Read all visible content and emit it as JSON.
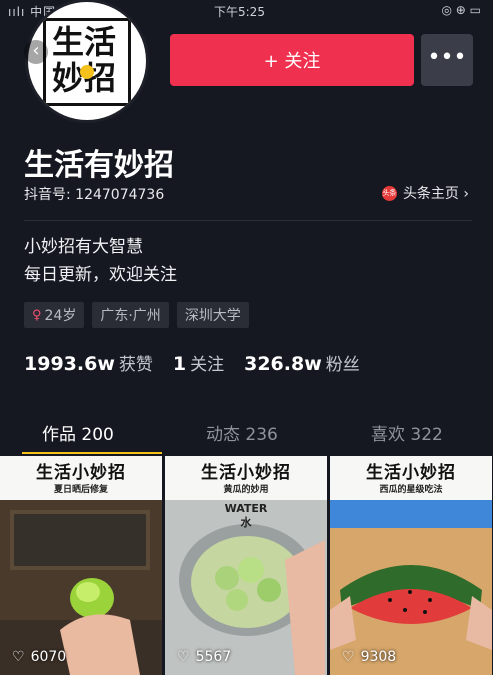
{
  "status_bar": {
    "left": "ıılı 中国移动",
    "time": "下午5:25",
    "right": "◎ ⊕ ▭"
  },
  "avatar": {
    "text_line1": "生活",
    "text_line2": "妙招"
  },
  "header": {
    "follow_label": "+ 关注",
    "more_label": "•••"
  },
  "profile": {
    "name": "生活有妙招",
    "douyin_id": "抖音号: 1247074736",
    "toutiao_label": "头条主页 ›",
    "bio_line1": "小妙招有大智慧",
    "bio_line2": "每日更新，欢迎关注"
  },
  "tags": [
    "24岁",
    "广东·广州",
    "深圳大学"
  ],
  "stats": {
    "likes_value": "1993.6w",
    "likes_label": "获赞",
    "following_value": "1",
    "following_label": "关注",
    "followers_value": "326.8w",
    "followers_label": "粉丝"
  },
  "tabs": [
    "作品 200",
    "动态 236",
    "喜欢 322"
  ],
  "videos": [
    {
      "title": "生活小妙招",
      "subtitle": "夏日晒后修复",
      "likes": "6070"
    },
    {
      "title": "生活小妙招",
      "subtitle": "黄瓜的妙用",
      "overlay": "WATER",
      "overlay2": "水",
      "likes": "5567"
    },
    {
      "title": "生活小妙招",
      "subtitle": "西瓜的星级吃法",
      "likes": "9308"
    }
  ],
  "colors": {
    "background": "#151821",
    "follow_button": "#f0304f",
    "accent": "#f5c21b"
  }
}
